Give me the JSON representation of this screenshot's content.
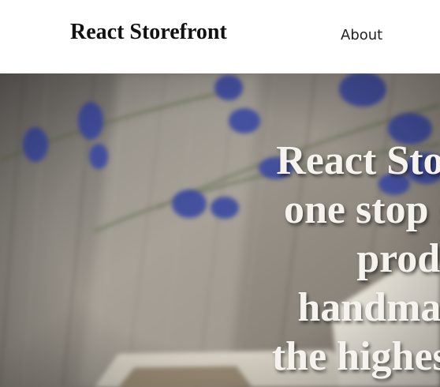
{
  "header": {
    "brand": "React Storefront",
    "nav_about": "About"
  },
  "hero": {
    "headline": "React Storefront - one stop shop for products handmade with the highest quality"
  },
  "colors": {
    "header_bg": "#ffffff",
    "hero_text": "#f6f3ee"
  }
}
